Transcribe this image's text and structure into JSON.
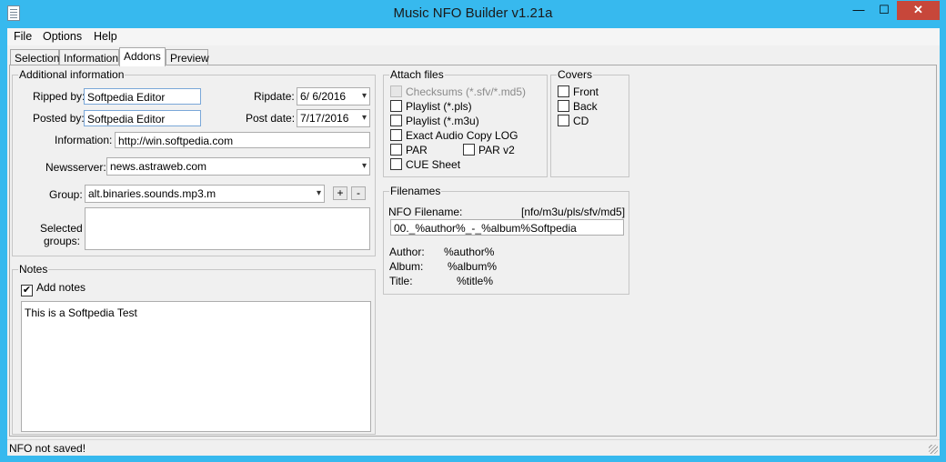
{
  "window": {
    "title": "Music NFO Builder v1.21a",
    "min_glyph": "—",
    "max_glyph": "☐",
    "close_glyph": "✕"
  },
  "menu": [
    "File",
    "Options",
    "Help"
  ],
  "tabs": [
    {
      "label": "Selection",
      "active": false
    },
    {
      "label": "Information",
      "active": false
    },
    {
      "label": "Addons",
      "active": true
    },
    {
      "label": "Preview",
      "active": false
    }
  ],
  "additional": {
    "legend": "Additional information",
    "ripped_by_label": "Ripped by:",
    "ripped_by": "Softpedia Editor",
    "posted_by_label": "Posted by:",
    "posted_by": "Softpedia Editor",
    "ripdate_label": "Ripdate:",
    "ripdate": "6/  6/2016",
    "post_date_label": "Post date:",
    "post_date": "7/17/2016",
    "information_label": "Information:",
    "information": "http://win.softpedia.com",
    "newsserver_label": "Newsserver:",
    "newsserver": "news.astraweb.com",
    "group_label": "Group:",
    "group": "alt.binaries.sounds.mp3.m",
    "add_glyph": "+",
    "remove_glyph": "-",
    "selected_groups_label_1": "Selected",
    "selected_groups_label_2": "groups:",
    "dropdown_glyph": "▾"
  },
  "notes": {
    "legend": "Notes",
    "add_notes_label": "Add notes",
    "add_notes_checked": true,
    "text": "This is a Softpedia Test"
  },
  "attach": {
    "legend": "Attach files",
    "checksums": "Checksums (*.sfv/*.md5)",
    "playlist_pls": "Playlist (*.pls)",
    "playlist_m3u": "Playlist (*.m3u)",
    "eac_log": "Exact Audio Copy LOG",
    "par": "PAR",
    "par2": "PAR v2",
    "cue": "CUE Sheet"
  },
  "covers": {
    "legend": "Covers",
    "front": "Front",
    "back": "Back",
    "cd": "CD"
  },
  "filenames": {
    "legend": "Filenames",
    "nfo_label": "NFO Filename:",
    "extensions": "[nfo/m3u/pls/sfv/md5]",
    "nfo_value": "00._%author%_-_%album%Softpedia",
    "author_label": "Author:",
    "author_var": "%author%",
    "album_label": "Album:",
    "album_var": "%album%",
    "title_label": "Title:",
    "title_var": "%title%"
  },
  "status": {
    "text": "NFO not saved!"
  },
  "check_glyph": "✔"
}
